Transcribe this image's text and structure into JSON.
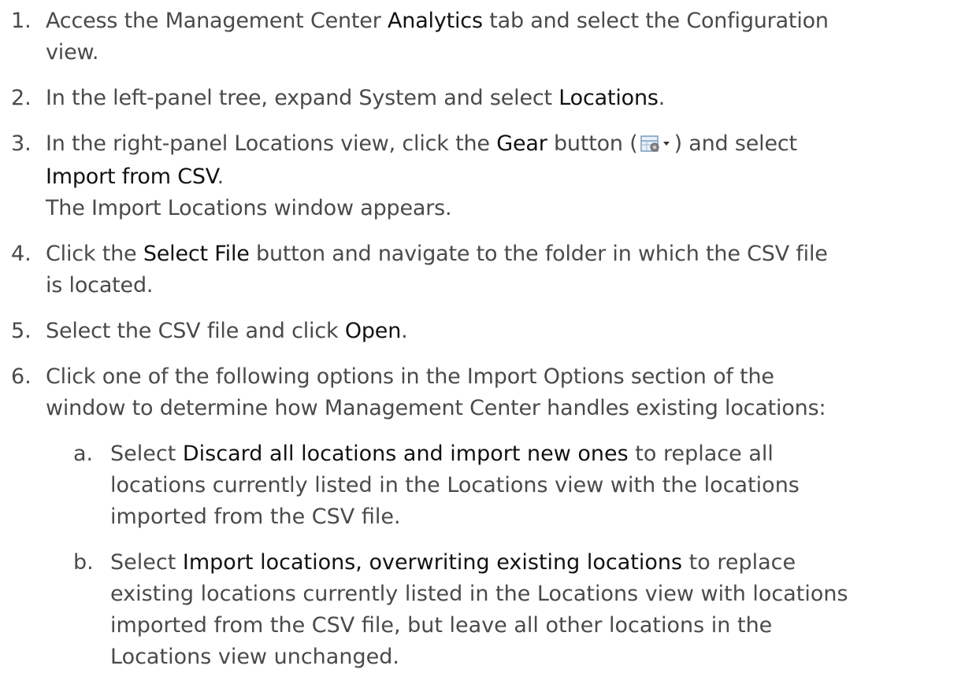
{
  "steps": [
    {
      "num": "1.",
      "t1": "Access the Management Center ",
      "b1": "Analytics",
      "t2": " tab and select the Configuration",
      "t3": "view."
    },
    {
      "num": "2.",
      "t1": "In the left-panel tree, expand System and select ",
      "b1": "Locations",
      "t2": "."
    },
    {
      "num": "3.",
      "t1": "In the right-panel Locations view, click the ",
      "b1": "Gear",
      "t2": " button (",
      "t3": ") and select",
      "b2": "Import from CSV",
      "t4": ".",
      "t5": "The Import Locations window appears.",
      "icon": "gear-dropdown-icon"
    },
    {
      "num": "4.",
      "t1": "Click the ",
      "b1": "Select File",
      "t2": " button and navigate to the folder in which the CSV file",
      "t3": "is located."
    },
    {
      "num": "5.",
      "t1": "Select the CSV file and click ",
      "b1": "Open",
      "t2": "."
    },
    {
      "num": "6.",
      "t1": "Click one of the following options in the Import Options section of the",
      "t2": "window to determine how Management Center handles existing locations:"
    }
  ],
  "substeps": [
    {
      "num": "a.",
      "t1": "Select ",
      "b1": "Discard all locations and import new ones",
      "t2": " to replace all",
      "t3": "locations currently listed in the Locations view with the locations",
      "t4": "imported from the CSV file."
    },
    {
      "num": "b.",
      "t1": "Select ",
      "b1": "Import locations, overwriting existing locations",
      "t2": " to replace",
      "t3": "existing locations currently listed in the Locations view with locations",
      "t4": "imported from the CSV file, but leave all other locations in the",
      "t5": "Locations view unchanged."
    }
  ]
}
